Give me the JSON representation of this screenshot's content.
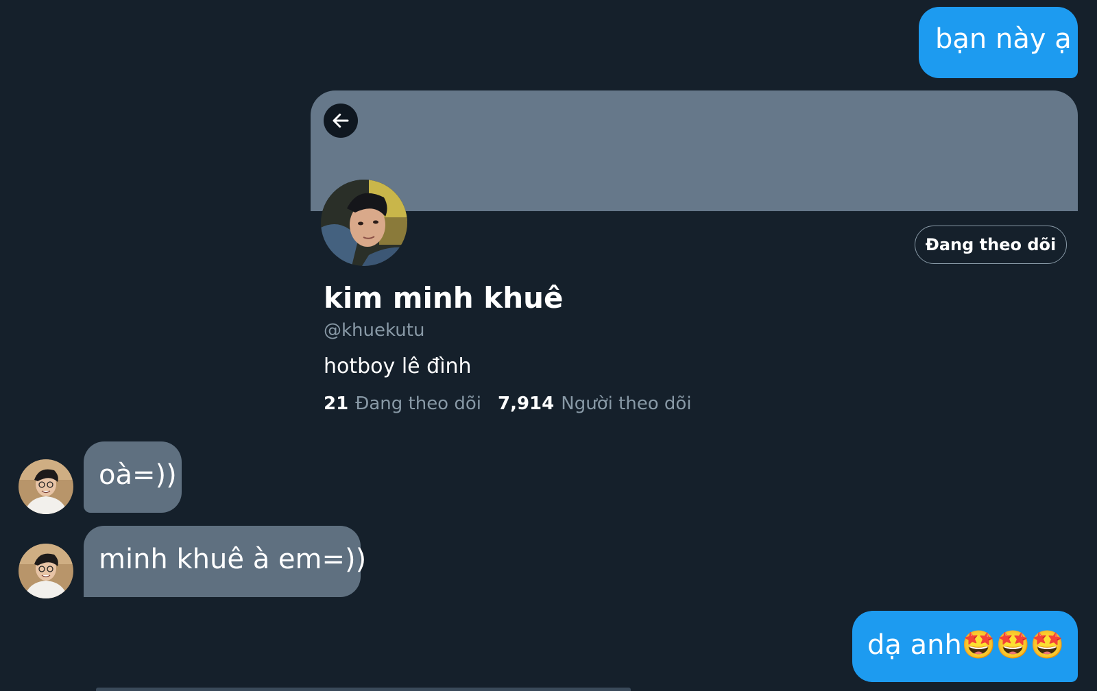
{
  "messages": [
    {
      "id": "m1",
      "direction": "sent",
      "text": "bạn này ạ"
    },
    {
      "id": "m2",
      "direction": "received",
      "text": "oà=))"
    },
    {
      "id": "m3",
      "direction": "received",
      "text": "minh khuê à em=))"
    },
    {
      "id": "m4",
      "direction": "sent",
      "text": "dạ anh🤩🤩🤩"
    }
  ],
  "profile_card": {
    "back_icon": "arrow-left-icon",
    "follow_button_label": "Đang theo dõi",
    "display_name": "kim minh khuê",
    "handle": "@khuekutu",
    "bio": "hotboy lê đình",
    "following_count": "21",
    "following_label": "Đang theo dõi",
    "followers_count": "7,914",
    "followers_label": "Người theo dõi"
  },
  "colors": {
    "background": "#15202b",
    "sent_bubble": "#1d9bf0",
    "received_bubble": "#5f7080",
    "banner": "#66788a",
    "muted_text": "#8899a6"
  }
}
